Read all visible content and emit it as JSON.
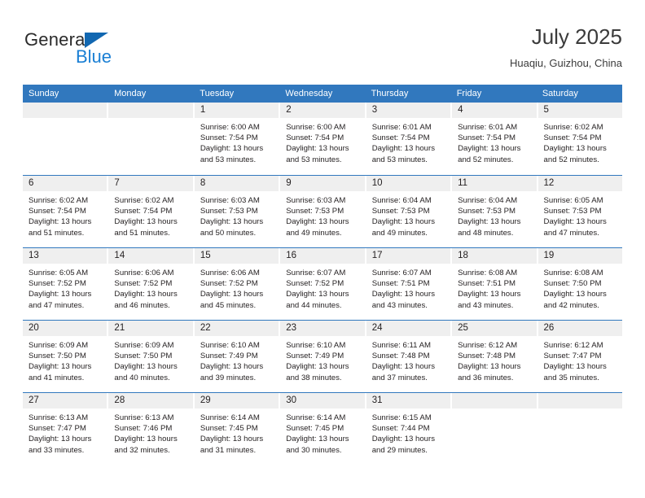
{
  "brand": {
    "name_part1": "General",
    "name_part2": "Blue",
    "triangle_color": "#1167b1",
    "blue_color": "#1a7fd4"
  },
  "header": {
    "title": "July 2025",
    "location": "Huaqiu, Guizhou, China"
  },
  "theme": {
    "header_bar_color": "#3178be",
    "daynum_band_color": "#efefef",
    "row_separator_color": "#3178be",
    "text_color": "#231f20"
  },
  "weekdays": [
    "Sunday",
    "Monday",
    "Tuesday",
    "Wednesday",
    "Thursday",
    "Friday",
    "Saturday"
  ],
  "weeks": [
    [
      {
        "day": "",
        "empty": true
      },
      {
        "day": "",
        "empty": true
      },
      {
        "day": "1",
        "sunrise": "Sunrise: 6:00 AM",
        "sunset": "Sunset: 7:54 PM",
        "daylight1": "Daylight: 13 hours",
        "daylight2": "and 53 minutes."
      },
      {
        "day": "2",
        "sunrise": "Sunrise: 6:00 AM",
        "sunset": "Sunset: 7:54 PM",
        "daylight1": "Daylight: 13 hours",
        "daylight2": "and 53 minutes."
      },
      {
        "day": "3",
        "sunrise": "Sunrise: 6:01 AM",
        "sunset": "Sunset: 7:54 PM",
        "daylight1": "Daylight: 13 hours",
        "daylight2": "and 53 minutes."
      },
      {
        "day": "4",
        "sunrise": "Sunrise: 6:01 AM",
        "sunset": "Sunset: 7:54 PM",
        "daylight1": "Daylight: 13 hours",
        "daylight2": "and 52 minutes."
      },
      {
        "day": "5",
        "sunrise": "Sunrise: 6:02 AM",
        "sunset": "Sunset: 7:54 PM",
        "daylight1": "Daylight: 13 hours",
        "daylight2": "and 52 minutes."
      }
    ],
    [
      {
        "day": "6",
        "sunrise": "Sunrise: 6:02 AM",
        "sunset": "Sunset: 7:54 PM",
        "daylight1": "Daylight: 13 hours",
        "daylight2": "and 51 minutes."
      },
      {
        "day": "7",
        "sunrise": "Sunrise: 6:02 AM",
        "sunset": "Sunset: 7:54 PM",
        "daylight1": "Daylight: 13 hours",
        "daylight2": "and 51 minutes."
      },
      {
        "day": "8",
        "sunrise": "Sunrise: 6:03 AM",
        "sunset": "Sunset: 7:53 PM",
        "daylight1": "Daylight: 13 hours",
        "daylight2": "and 50 minutes."
      },
      {
        "day": "9",
        "sunrise": "Sunrise: 6:03 AM",
        "sunset": "Sunset: 7:53 PM",
        "daylight1": "Daylight: 13 hours",
        "daylight2": "and 49 minutes."
      },
      {
        "day": "10",
        "sunrise": "Sunrise: 6:04 AM",
        "sunset": "Sunset: 7:53 PM",
        "daylight1": "Daylight: 13 hours",
        "daylight2": "and 49 minutes."
      },
      {
        "day": "11",
        "sunrise": "Sunrise: 6:04 AM",
        "sunset": "Sunset: 7:53 PM",
        "daylight1": "Daylight: 13 hours",
        "daylight2": "and 48 minutes."
      },
      {
        "day": "12",
        "sunrise": "Sunrise: 6:05 AM",
        "sunset": "Sunset: 7:53 PM",
        "daylight1": "Daylight: 13 hours",
        "daylight2": "and 47 minutes."
      }
    ],
    [
      {
        "day": "13",
        "sunrise": "Sunrise: 6:05 AM",
        "sunset": "Sunset: 7:52 PM",
        "daylight1": "Daylight: 13 hours",
        "daylight2": "and 47 minutes."
      },
      {
        "day": "14",
        "sunrise": "Sunrise: 6:06 AM",
        "sunset": "Sunset: 7:52 PM",
        "daylight1": "Daylight: 13 hours",
        "daylight2": "and 46 minutes."
      },
      {
        "day": "15",
        "sunrise": "Sunrise: 6:06 AM",
        "sunset": "Sunset: 7:52 PM",
        "daylight1": "Daylight: 13 hours",
        "daylight2": "and 45 minutes."
      },
      {
        "day": "16",
        "sunrise": "Sunrise: 6:07 AM",
        "sunset": "Sunset: 7:52 PM",
        "daylight1": "Daylight: 13 hours",
        "daylight2": "and 44 minutes."
      },
      {
        "day": "17",
        "sunrise": "Sunrise: 6:07 AM",
        "sunset": "Sunset: 7:51 PM",
        "daylight1": "Daylight: 13 hours",
        "daylight2": "and 43 minutes."
      },
      {
        "day": "18",
        "sunrise": "Sunrise: 6:08 AM",
        "sunset": "Sunset: 7:51 PM",
        "daylight1": "Daylight: 13 hours",
        "daylight2": "and 43 minutes."
      },
      {
        "day": "19",
        "sunrise": "Sunrise: 6:08 AM",
        "sunset": "Sunset: 7:50 PM",
        "daylight1": "Daylight: 13 hours",
        "daylight2": "and 42 minutes."
      }
    ],
    [
      {
        "day": "20",
        "sunrise": "Sunrise: 6:09 AM",
        "sunset": "Sunset: 7:50 PM",
        "daylight1": "Daylight: 13 hours",
        "daylight2": "and 41 minutes."
      },
      {
        "day": "21",
        "sunrise": "Sunrise: 6:09 AM",
        "sunset": "Sunset: 7:50 PM",
        "daylight1": "Daylight: 13 hours",
        "daylight2": "and 40 minutes."
      },
      {
        "day": "22",
        "sunrise": "Sunrise: 6:10 AM",
        "sunset": "Sunset: 7:49 PM",
        "daylight1": "Daylight: 13 hours",
        "daylight2": "and 39 minutes."
      },
      {
        "day": "23",
        "sunrise": "Sunrise: 6:10 AM",
        "sunset": "Sunset: 7:49 PM",
        "daylight1": "Daylight: 13 hours",
        "daylight2": "and 38 minutes."
      },
      {
        "day": "24",
        "sunrise": "Sunrise: 6:11 AM",
        "sunset": "Sunset: 7:48 PM",
        "daylight1": "Daylight: 13 hours",
        "daylight2": "and 37 minutes."
      },
      {
        "day": "25",
        "sunrise": "Sunrise: 6:12 AM",
        "sunset": "Sunset: 7:48 PM",
        "daylight1": "Daylight: 13 hours",
        "daylight2": "and 36 minutes."
      },
      {
        "day": "26",
        "sunrise": "Sunrise: 6:12 AM",
        "sunset": "Sunset: 7:47 PM",
        "daylight1": "Daylight: 13 hours",
        "daylight2": "and 35 minutes."
      }
    ],
    [
      {
        "day": "27",
        "sunrise": "Sunrise: 6:13 AM",
        "sunset": "Sunset: 7:47 PM",
        "daylight1": "Daylight: 13 hours",
        "daylight2": "and 33 minutes."
      },
      {
        "day": "28",
        "sunrise": "Sunrise: 6:13 AM",
        "sunset": "Sunset: 7:46 PM",
        "daylight1": "Daylight: 13 hours",
        "daylight2": "and 32 minutes."
      },
      {
        "day": "29",
        "sunrise": "Sunrise: 6:14 AM",
        "sunset": "Sunset: 7:45 PM",
        "daylight1": "Daylight: 13 hours",
        "daylight2": "and 31 minutes."
      },
      {
        "day": "30",
        "sunrise": "Sunrise: 6:14 AM",
        "sunset": "Sunset: 7:45 PM",
        "daylight1": "Daylight: 13 hours",
        "daylight2": "and 30 minutes."
      },
      {
        "day": "31",
        "sunrise": "Sunrise: 6:15 AM",
        "sunset": "Sunset: 7:44 PM",
        "daylight1": "Daylight: 13 hours",
        "daylight2": "and 29 minutes."
      },
      {
        "day": "",
        "empty": true
      },
      {
        "day": "",
        "empty": true
      }
    ]
  ]
}
